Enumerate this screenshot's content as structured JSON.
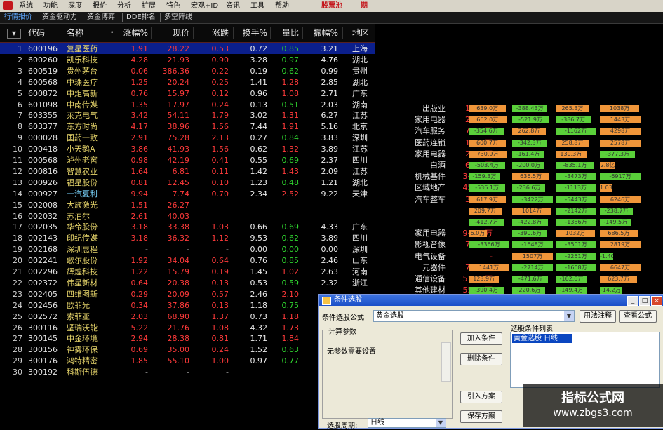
{
  "menu": {
    "items": [
      "系统",
      "功能",
      "深度",
      "报价",
      "分析",
      "扩展",
      "特色",
      "宏观+ID",
      "资讯",
      "工具",
      "帮助"
    ],
    "right_items": [
      "股票池",
      "期"
    ]
  },
  "tabs": [
    "行情报价",
    "资金驱动力",
    "资金博弈",
    "DDE排名",
    "多空阵线"
  ],
  "table": {
    "headers": [
      "代码",
      "名称",
      "涨幅%",
      "现价",
      "涨跌",
      "换手%",
      "量比",
      "振幅%",
      "地区"
    ],
    "rows": [
      {
        "i": "1",
        "code": "600196",
        "name": "复星医药",
        "chg": "1.91",
        "price": "28.22",
        "diff": "0.53",
        "turn": "0.72",
        "vr": "0.85",
        "amp": "3.21",
        "region": "上海",
        "sel": true
      },
      {
        "i": "2",
        "code": "600260",
        "name": "凯乐科技",
        "chg": "4.28",
        "price": "21.93",
        "diff": "0.90",
        "turn": "3.28",
        "vr": "0.97",
        "amp": "4.76",
        "region": "湖北"
      },
      {
        "i": "3",
        "code": "600519",
        "name": "贵州茅台",
        "chg": "0.06",
        "price": "386.36",
        "diff": "0.22",
        "turn": "0.19",
        "vr": "0.62",
        "amp": "0.99",
        "region": "贵州"
      },
      {
        "i": "4",
        "code": "600568",
        "name": "中珠医疗",
        "chg": "1.25",
        "price": "20.24",
        "diff": "0.25",
        "turn": "1.41",
        "vr": "1.28",
        "amp": "2.85",
        "region": "湖北"
      },
      {
        "i": "5",
        "code": "600872",
        "name": "中炬高新",
        "chg": "0.76",
        "price": "15.97",
        "diff": "0.12",
        "turn": "0.96",
        "vr": "1.08",
        "amp": "2.71",
        "region": "广东"
      },
      {
        "i": "6",
        "code": "601098",
        "name": "中南传媒",
        "chg": "1.35",
        "price": "17.97",
        "diff": "0.24",
        "turn": "0.13",
        "vr": "0.51",
        "amp": "2.03",
        "region": "湖南"
      },
      {
        "i": "7",
        "code": "603355",
        "name": "莱克电气",
        "chg": "3.42",
        "price": "54.11",
        "diff": "1.79",
        "turn": "3.02",
        "vr": "1.31",
        "amp": "6.27",
        "region": "江苏"
      },
      {
        "i": "8",
        "code": "603377",
        "name": "东方时尚",
        "chg": "4.17",
        "price": "38.96",
        "diff": "1.56",
        "turn": "7.44",
        "vr": "1.91",
        "amp": "5.16",
        "region": "北京"
      },
      {
        "i": "9",
        "code": "000028",
        "name": "国药一致",
        "chg": "2.91",
        "price": "75.28",
        "diff": "2.13",
        "turn": "0.27",
        "vr": "0.84",
        "amp": "3.83",
        "region": "深圳"
      },
      {
        "i": "10",
        "code": "000418",
        "name": "小天鹅A",
        "chg": "3.86",
        "price": "41.93",
        "diff": "1.56",
        "turn": "0.62",
        "vr": "1.32",
        "amp": "3.89",
        "region": "江苏"
      },
      {
        "i": "11",
        "code": "000568",
        "name": "泸州老窖",
        "chg": "0.98",
        "price": "42.19",
        "diff": "0.41",
        "turn": "0.55",
        "vr": "0.69",
        "amp": "2.37",
        "region": "四川"
      },
      {
        "i": "12",
        "code": "000816",
        "name": "智慧农业",
        "chg": "1.64",
        "price": "6.81",
        "diff": "0.11",
        "turn": "1.42",
        "vr": "1.43",
        "amp": "2.09",
        "region": "江苏"
      },
      {
        "i": "13",
        "code": "000926",
        "name": "福星股份",
        "chg": "0.81",
        "price": "12.45",
        "diff": "0.10",
        "turn": "1.23",
        "vr": "0.48",
        "amp": "1.21",
        "region": "湖北"
      },
      {
        "i": "14",
        "code": "000927",
        "name": "一汽夏利",
        "chg": "9.94",
        "price": "7.74",
        "diff": "0.70",
        "turn": "2.34",
        "vr": "2.52",
        "amp": "9.22",
        "region": "天津",
        "cyan": true
      },
      {
        "i": "15",
        "code": "002008",
        "name": "大族激光",
        "chg": "1.51",
        "price": "26.27",
        "diff": "",
        "turn": "",
        "vr": "",
        "amp": "",
        "region": ""
      },
      {
        "i": "16",
        "code": "002032",
        "name": "苏泊尔",
        "chg": "2.61",
        "price": "40.03",
        "diff": "",
        "turn": "",
        "vr": "",
        "amp": "",
        "region": ""
      },
      {
        "i": "17",
        "code": "002035",
        "name": "华帝股份",
        "chg": "3.18",
        "price": "33.38",
        "diff": "1.03",
        "turn": "0.66",
        "vr": "0.69",
        "amp": "4.33",
        "region": "广东"
      },
      {
        "i": "18",
        "code": "002143",
        "name": "印纪传媒",
        "chg": "3.18",
        "price": "36.32",
        "diff": "1.12",
        "turn": "9.53",
        "vr": "0.62",
        "amp": "3.89",
        "region": "四川"
      },
      {
        "i": "19",
        "code": "002168",
        "name": "深圳惠程",
        "chg": "-",
        "price": "-",
        "diff": "-",
        "turn": "0.00",
        "vr": "0.00",
        "amp": "0.00",
        "region": "深圳"
      },
      {
        "i": "20",
        "code": "002241",
        "name": "歌尔股份",
        "chg": "1.92",
        "price": "34.04",
        "diff": "0.64",
        "turn": "0.76",
        "vr": "0.85",
        "amp": "2.46",
        "region": "山东"
      },
      {
        "i": "21",
        "code": "002296",
        "name": "辉煌科技",
        "chg": "1.22",
        "price": "15.79",
        "diff": "0.19",
        "turn": "1.45",
        "vr": "1.02",
        "amp": "2.63",
        "region": "河南"
      },
      {
        "i": "22",
        "code": "002372",
        "name": "伟星新材",
        "chg": "0.64",
        "price": "20.38",
        "diff": "0.13",
        "turn": "0.53",
        "vr": "0.59",
        "amp": "2.32",
        "region": "浙江"
      },
      {
        "i": "23",
        "code": "002405",
        "name": "四维图新",
        "chg": "0.29",
        "price": "20.09",
        "diff": "0.57",
        "turn": "2.46",
        "vr": "2.10",
        "amp": "",
        "region": ""
      },
      {
        "i": "24",
        "code": "002456",
        "name": "欧菲光",
        "chg": "0.34",
        "price": "37.86",
        "diff": "0.13",
        "turn": "1.18",
        "vr": "0.75",
        "amp": "",
        "region": ""
      },
      {
        "i": "25",
        "code": "002572",
        "name": "索菲亚",
        "chg": "2.03",
        "price": "68.90",
        "diff": "1.37",
        "turn": "0.73",
        "vr": "1.18",
        "amp": "",
        "region": ""
      },
      {
        "i": "26",
        "code": "300116",
        "name": "坚瑞沃能",
        "chg": "5.22",
        "price": "21.76",
        "diff": "1.08",
        "turn": "4.32",
        "vr": "1.73",
        "amp": "",
        "region": ""
      },
      {
        "i": "27",
        "code": "300145",
        "name": "中金环境",
        "chg": "2.94",
        "price": "28.38",
        "diff": "0.81",
        "turn": "1.71",
        "vr": "1.84",
        "amp": "",
        "region": ""
      },
      {
        "i": "28",
        "code": "300156",
        "name": "神雾环保",
        "chg": "0.69",
        "price": "35.00",
        "diff": "0.24",
        "turn": "1.52",
        "vr": "0.63",
        "amp": "",
        "region": ""
      },
      {
        "i": "29",
        "code": "300176",
        "name": "鸿特精密",
        "chg": "1.85",
        "price": "55.10",
        "diff": "1.00",
        "turn": "0.97",
        "vr": "0.77",
        "amp": "",
        "region": ""
      },
      {
        "i": "30",
        "code": "300192",
        "name": "科斯伍德",
        "chg": "-",
        "price": "-",
        "diff": "-",
        "turn": "",
        "vr": "",
        "amp": "",
        "region": ""
      }
    ]
  },
  "right_rows": [
    {
      "ind": "出版业",
      "amt": "1830万",
      "b": [
        "639.0万",
        "-388.43万",
        "265.3万",
        "1038万"
      ]
    },
    {
      "ind": "家用电器",
      "amt": "2210万",
      "b": [
        "662.0万",
        "-521.9万",
        "-386.7万",
        "1443万"
      ]
    },
    {
      "ind": "汽车服务",
      "amt": "7079万",
      "b": [
        "-354.6万",
        "262.8万",
        "-1162万",
        "4298万"
      ]
    },
    {
      "ind": "医药连锁",
      "amt": "1690万",
      "b": [
        "600.7万",
        "-342.3万",
        "258.8万",
        "2578万"
      ]
    },
    {
      "ind": "家用电器",
      "amt": "2296万",
      "b": [
        "730.9万",
        "-161.4万",
        "130.3万",
        "-377.3万"
      ]
    },
    {
      "ind": "白酒",
      "amt": "6709万",
      "b": [
        "-503.4万",
        "-200.0万",
        "-835.1万",
        "2.8亿"
      ]
    },
    {
      "ind": "机械基件",
      "amt": "346.4万",
      "b": [
        "-159.3万",
        "636.5万",
        "-3473万",
        "-6917万"
      ]
    },
    {
      "ind": "区域地产",
      "amt": "450.5万",
      "b": [
        "-536.1万",
        "-236.6万",
        "-1113万",
        "1.03亿"
      ]
    },
    {
      "ind": "汽车整车",
      "amt": "3592万",
      "b": [
        "617.9万",
        "-3422万",
        "-5443万",
        "6246万"
      ]
    },
    {
      "ind": "",
      "amt": "",
      "b": [
        "209.7万",
        "1014万",
        "-2142万",
        "-238.7万"
      ]
    },
    {
      "ind": "",
      "amt": "",
      "b": [
        "-412.7万",
        "-422.8万",
        "-1386万",
        "-149.5万"
      ]
    },
    {
      "ind": "家用电器",
      "amt": "941.9万",
      "b": [
        "6.0万",
        "-390.6万",
        "1032万",
        "686.5万"
      ]
    },
    {
      "ind": "影视音像",
      "amt": "7717万",
      "b": [
        "-3366万",
        "-1648万",
        "-3501万",
        "2819万"
      ]
    },
    {
      "ind": "电气设备",
      "amt": "-",
      "b": [
        "",
        "1507万",
        "-2251万",
        "-1.40万"
      ]
    },
    {
      "ind": "元器件",
      "amt": "7143万",
      "b": [
        "1441万",
        "-2714万",
        "-1608万",
        "6647万"
      ]
    },
    {
      "ind": "通信设备",
      "amt": "512.7万",
      "b": [
        "123.9万",
        "-471.6万",
        "-162.6万",
        "623.7万"
      ]
    },
    {
      "ind": "其他建材",
      "amt": "557.1万",
      "b": [
        "-390.4万",
        "-220.6万",
        "-149.4万",
        "-14.2万"
      ]
    }
  ],
  "dialog": {
    "title": "条件选股",
    "formula_label": "条件选股公式",
    "formula_value": "黄金选股",
    "usage_btn": "用法注释",
    "view_btn": "查看公式",
    "params_group": "计算参数",
    "params_text": "无参数需要设置",
    "add_btn": "加入条件",
    "del_btn": "删除条件",
    "import_btn": "引入方案",
    "save_btn": "保存方案",
    "list_title": "选股条件列表",
    "list_item": "黄金选股  日线",
    "period_label": "选股周期:",
    "period_value": "日线",
    "win_min": "_",
    "win_max": "□",
    "win_close": "×"
  },
  "watermark": {
    "line1": "指标公式网",
    "line2": "www.zbgs3.com"
  },
  "colors": {
    "up": "#ff3a3a",
    "down": "#2fd42f",
    "selected_row": "#0b1f8c",
    "name": "#e6d46a"
  }
}
